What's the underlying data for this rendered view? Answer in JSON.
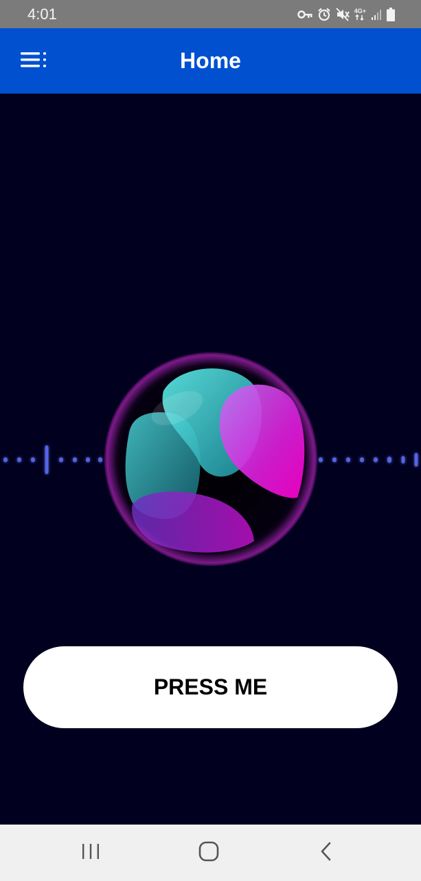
{
  "status_bar": {
    "time": "4:01",
    "network_label": "4G+",
    "icons": [
      "vpn-key-icon",
      "alarm-icon",
      "mute-icon",
      "network-4g-icon",
      "signal-icon",
      "battery-icon"
    ]
  },
  "app_bar": {
    "title": "Home",
    "menu_icon": "menu-icon",
    "color": "#0050d0"
  },
  "visualizer": {
    "orb_colors": [
      "#4de4e4",
      "#e020e0",
      "#8a2be2"
    ],
    "wave_color": "#5a6cf0"
  },
  "main": {
    "press_button_label": "PRESS ME"
  },
  "nav_bar": {
    "buttons": [
      "recent-apps-icon",
      "home-icon",
      "back-icon"
    ]
  },
  "colors": {
    "background": "#02001f",
    "status_bar": "#7b7b7b",
    "nav_bar": "#f0f0f0"
  }
}
